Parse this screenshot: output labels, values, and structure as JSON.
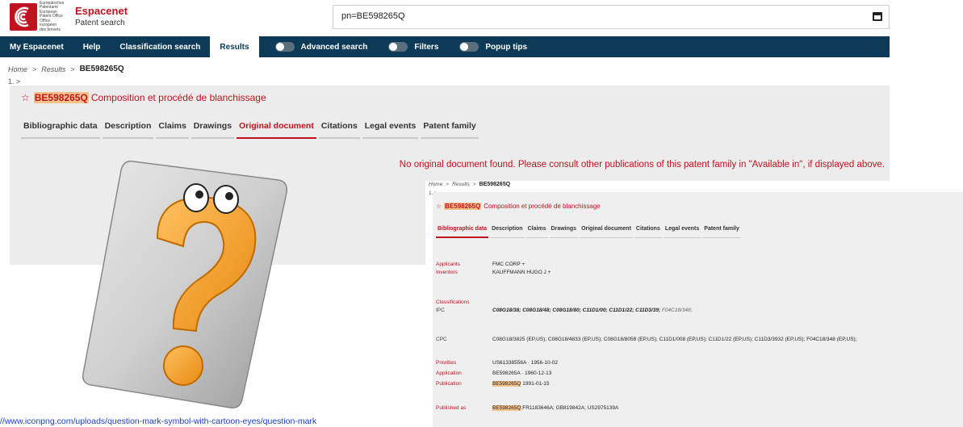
{
  "header": {
    "logo_text": "Europäisches Patentamt European Patent Office Office européen des brevets",
    "brand_name_a": "Espace",
    "brand_name_b": "net",
    "brand_sub": "Patent search",
    "search_value": "pn=BE598265Q"
  },
  "nav": {
    "my_espacenet": "My Espacenet",
    "help": "Help",
    "classification": "Classification search",
    "results": "Results",
    "advanced": "Advanced search",
    "filters": "Filters",
    "popup": "Popup tips"
  },
  "breadcrumb": {
    "home": "Home",
    "results": "Results",
    "current": "BE598265Q",
    "result_num": "1. >"
  },
  "document": {
    "number": "BE598265Q",
    "title": "Composition et procédé de blanchissage",
    "tabs": [
      "Bibliographic data",
      "Description",
      "Claims",
      "Drawings",
      "Original document",
      "Citations",
      "Legal events",
      "Patent family"
    ],
    "active_tab_main": "Original document",
    "no_doc_message": "No original document found. Please consult other publications of this patent family in \"Available in\", if displayed above."
  },
  "image": {
    "icon": "question-mark-icon",
    "url": "//www.iconpng.com/uploads/question-mark-symbol-with-cartoon-eyes/question-mark"
  },
  "overlay": {
    "active_tab": "Bibliographic data",
    "labels": {
      "applicants": "Applicants",
      "inventors": "Inventors",
      "classifications": "Classifications",
      "ipc": "IPC",
      "cpc": "CPC",
      "priorities": "Priorities",
      "application": "Application",
      "publication": "Publication",
      "published_as": "Published as"
    },
    "values": {
      "applicants": "FMC CORP  +",
      "inventors": "KAUFFMANN HUGO J  +",
      "ipc": "C08G18/38; C08G18/48; C08G18/80; C11D1/00; C11D1/22; C11D3/39;",
      "ipc_extra": "F04C18/348;",
      "cpc": "C08G18/3825 (EP,US); C08G18/4833 (EP,US); C08G18/8058 (EP,US); C11D1/008 (EP,US); C11D1/22 (EP,US); C11D3/3932 (EP,US); F04C18/348 (EP,US);",
      "priorities": "US61338556A · 1956-10-02",
      "application": "BE598265A · 1960-12-13",
      "publication_num": "BE598265Q",
      "publication_date": "1991-01-15",
      "published_as_num": "BE598265Q",
      "published_as_rest": ";FR1183646A; GB819842A; US2975139A"
    }
  },
  "colors": {
    "brand_red": "#c1121f",
    "nav_blue": "#0c3a57",
    "highlight": "#f5c28a",
    "panel_gray": "#ececec"
  }
}
